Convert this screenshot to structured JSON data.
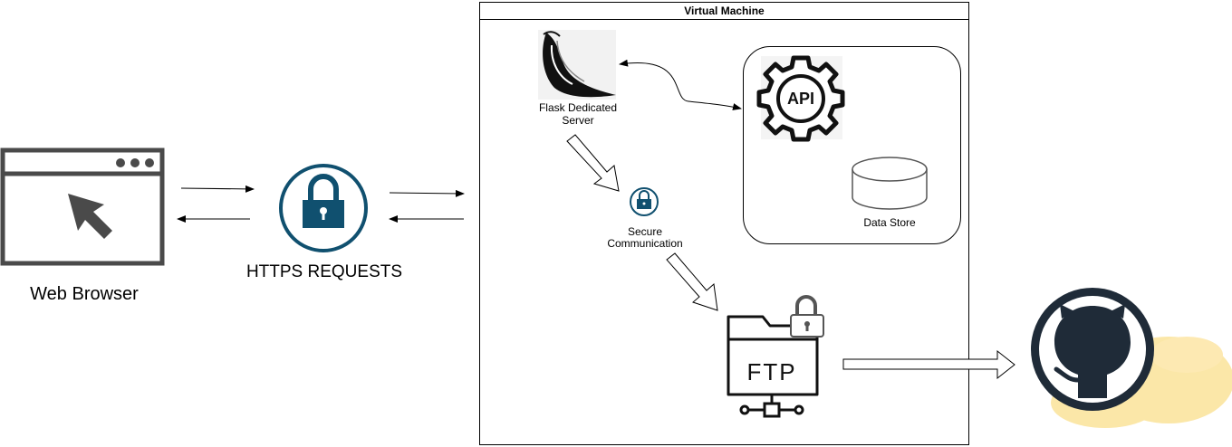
{
  "diagram": {
    "title": "Virtual Machine",
    "nodes": {
      "web_browser": {
        "label": "Web Browser",
        "icon": "browser-window-icon"
      },
      "https_requests": {
        "label": "HTTPS REQUESTS",
        "icon": "padlock-circle-icon"
      },
      "flask_server": {
        "label": "Flask Dedicated Server",
        "icon": "flask-horn-icon"
      },
      "api": {
        "label": "API",
        "icon": "api-gear-icon"
      },
      "data_store": {
        "label": "Data Store",
        "icon": "database-cylinder-icon"
      },
      "secure_communication": {
        "label": "Secure Communication",
        "icon": "padlock-circle-icon"
      },
      "ftp": {
        "label": "FTP",
        "icon": "ftp-folder-icon"
      },
      "github": {
        "label": "",
        "icon": "github-cloud-icon"
      }
    },
    "edges": [
      {
        "from": "web_browser",
        "to": "https_requests",
        "style": "thin-arrow"
      },
      {
        "from": "https_requests",
        "to": "web_browser",
        "style": "thin-arrow"
      },
      {
        "from": "https_requests",
        "to": "virtual_machine",
        "style": "thin-arrow"
      },
      {
        "from": "virtual_machine",
        "to": "https_requests",
        "style": "thin-arrow"
      },
      {
        "from": "flask_server",
        "to": "api",
        "style": "curved-double-arrow"
      },
      {
        "from": "flask_server",
        "to": "secure_communication",
        "style": "block-arrow"
      },
      {
        "from": "secure_communication",
        "to": "ftp",
        "style": "block-arrow"
      },
      {
        "from": "ftp",
        "to": "github",
        "style": "block-arrow"
      }
    ],
    "colors": {
      "lock_blue": "#10506f",
      "icon_gray": "#4a4a4a",
      "github_dark": "#1f2b38",
      "cloud_yellow": "#fbe7a8"
    }
  }
}
